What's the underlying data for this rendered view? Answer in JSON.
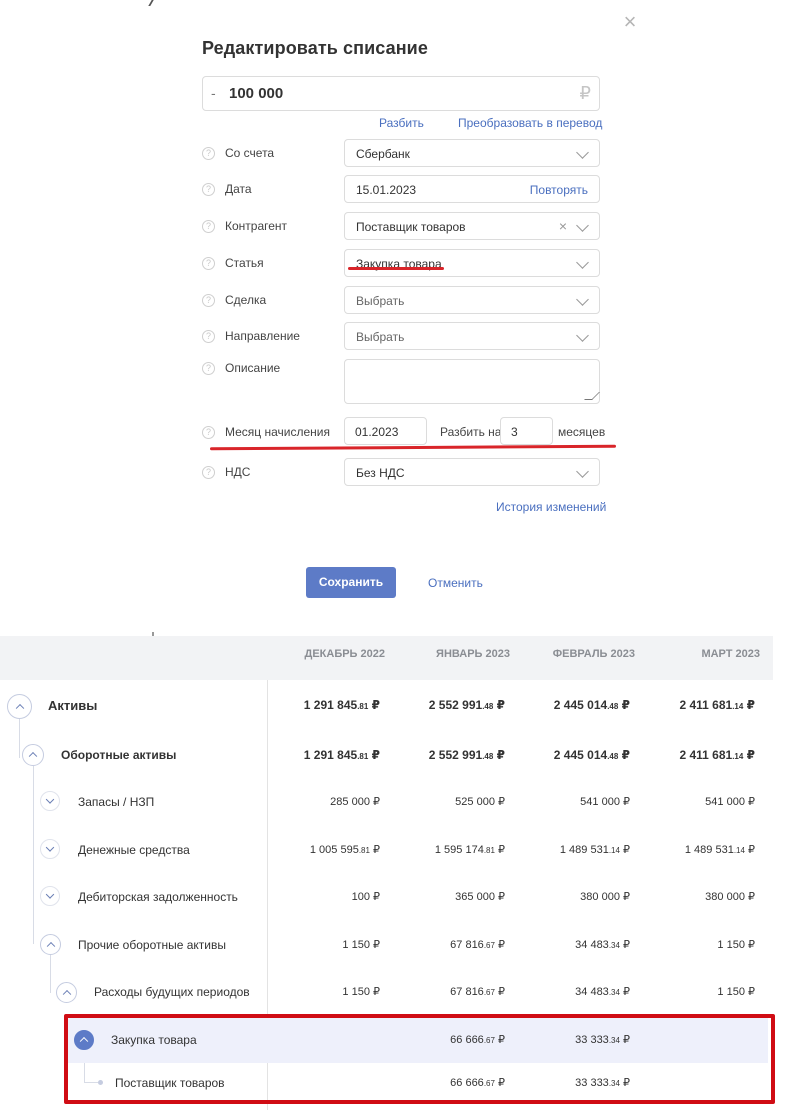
{
  "modal": {
    "title": "Редактировать списание",
    "close_glyph": "×",
    "amount": {
      "sign": "-",
      "value": "100 000",
      "currency": "₽"
    },
    "links": {
      "split": "Разбить",
      "convert": "Преобразовать в перевод",
      "history": "История изменений"
    },
    "fields": {
      "account": {
        "label": "Со счета",
        "value": "Сбербанк"
      },
      "date": {
        "label": "Дата",
        "value": "15.01.2023",
        "link": "Повторять"
      },
      "counterparty": {
        "label": "Контрагент",
        "value": "Поставщик товаров"
      },
      "article": {
        "label": "Статья",
        "value": "Закупка товара"
      },
      "deal": {
        "label": "Сделка",
        "placeholder": "Выбрать"
      },
      "direction": {
        "label": "Направление",
        "placeholder": "Выбрать"
      },
      "description": {
        "label": "Описание",
        "value": ""
      },
      "accrual": {
        "label": "Месяц начисления",
        "value": "01.2023",
        "split_label": "Разбить на",
        "split_value": "3",
        "months_label": "месяцев"
      },
      "vat": {
        "label": "НДС",
        "value": "Без НДС"
      }
    },
    "buttons": {
      "save": "Сохранить",
      "cancel": "Отменить"
    },
    "help_glyph": "?"
  },
  "table": {
    "columns": [
      "ДЕКАБРЬ 2022",
      "ЯНВАРЬ 2023",
      "ФЕВРАЛЬ 2023",
      "МАРТ 2023"
    ],
    "rows": [
      {
        "label": "Активы",
        "cells": [
          [
            "1 291 845",
            ".81",
            " ₽"
          ],
          [
            "2 552 991",
            ".48",
            " ₽"
          ],
          [
            "2 445 014",
            ".48",
            " ₽"
          ],
          [
            "2 411 681",
            ".14",
            " ₽"
          ]
        ]
      },
      {
        "label": "Оборотные активы",
        "cells": [
          [
            "1 291 845",
            ".81",
            " ₽"
          ],
          [
            "2 552 991",
            ".48",
            " ₽"
          ],
          [
            "2 445 014",
            ".48",
            " ₽"
          ],
          [
            "2 411 681",
            ".14",
            " ₽"
          ]
        ]
      },
      {
        "label": "Запасы / НЗП",
        "cells": [
          [
            "285 000",
            "",
            " ₽"
          ],
          [
            "525 000",
            "",
            " ₽"
          ],
          [
            "541 000",
            "",
            " ₽"
          ],
          [
            "541 000",
            "",
            " ₽"
          ]
        ]
      },
      {
        "label": "Денежные средства",
        "cells": [
          [
            "1 005 595",
            ".81",
            " ₽"
          ],
          [
            "1 595 174",
            ".81",
            " ₽"
          ],
          [
            "1 489 531",
            ".14",
            " ₽"
          ],
          [
            "1 489 531",
            ".14",
            " ₽"
          ]
        ]
      },
      {
        "label": "Дебиторская задолженность",
        "cells": [
          [
            "100",
            "",
            " ₽"
          ],
          [
            "365 000",
            "",
            " ₽"
          ],
          [
            "380 000",
            "",
            " ₽"
          ],
          [
            "380 000",
            "",
            " ₽"
          ]
        ]
      },
      {
        "label": "Прочие оборотные активы",
        "cells": [
          [
            "1 150",
            "",
            " ₽"
          ],
          [
            "67 816",
            ".67",
            " ₽"
          ],
          [
            "34 483",
            ".34",
            " ₽"
          ],
          [
            "1 150",
            "",
            " ₽"
          ]
        ]
      },
      {
        "label": "Расходы будущих периодов",
        "cells": [
          [
            "1 150",
            "",
            " ₽"
          ],
          [
            "67 816",
            ".67",
            " ₽"
          ],
          [
            "34 483",
            ".34",
            " ₽"
          ],
          [
            "1 150",
            "",
            " ₽"
          ]
        ]
      },
      {
        "label": "Закупка товара",
        "cells": [
          [
            "",
            "",
            ""
          ],
          [
            "66 666",
            ".67",
            " ₽"
          ],
          [
            "33 333",
            ".34",
            " ₽"
          ],
          [
            "",
            "",
            ""
          ]
        ]
      },
      {
        "label": "Поставщик товаров",
        "cells": [
          [
            "",
            "",
            ""
          ],
          [
            "66 666",
            ".67",
            " ₽"
          ],
          [
            "33 333",
            ".34",
            " ₽"
          ],
          [
            "",
            "",
            ""
          ]
        ]
      }
    ]
  }
}
